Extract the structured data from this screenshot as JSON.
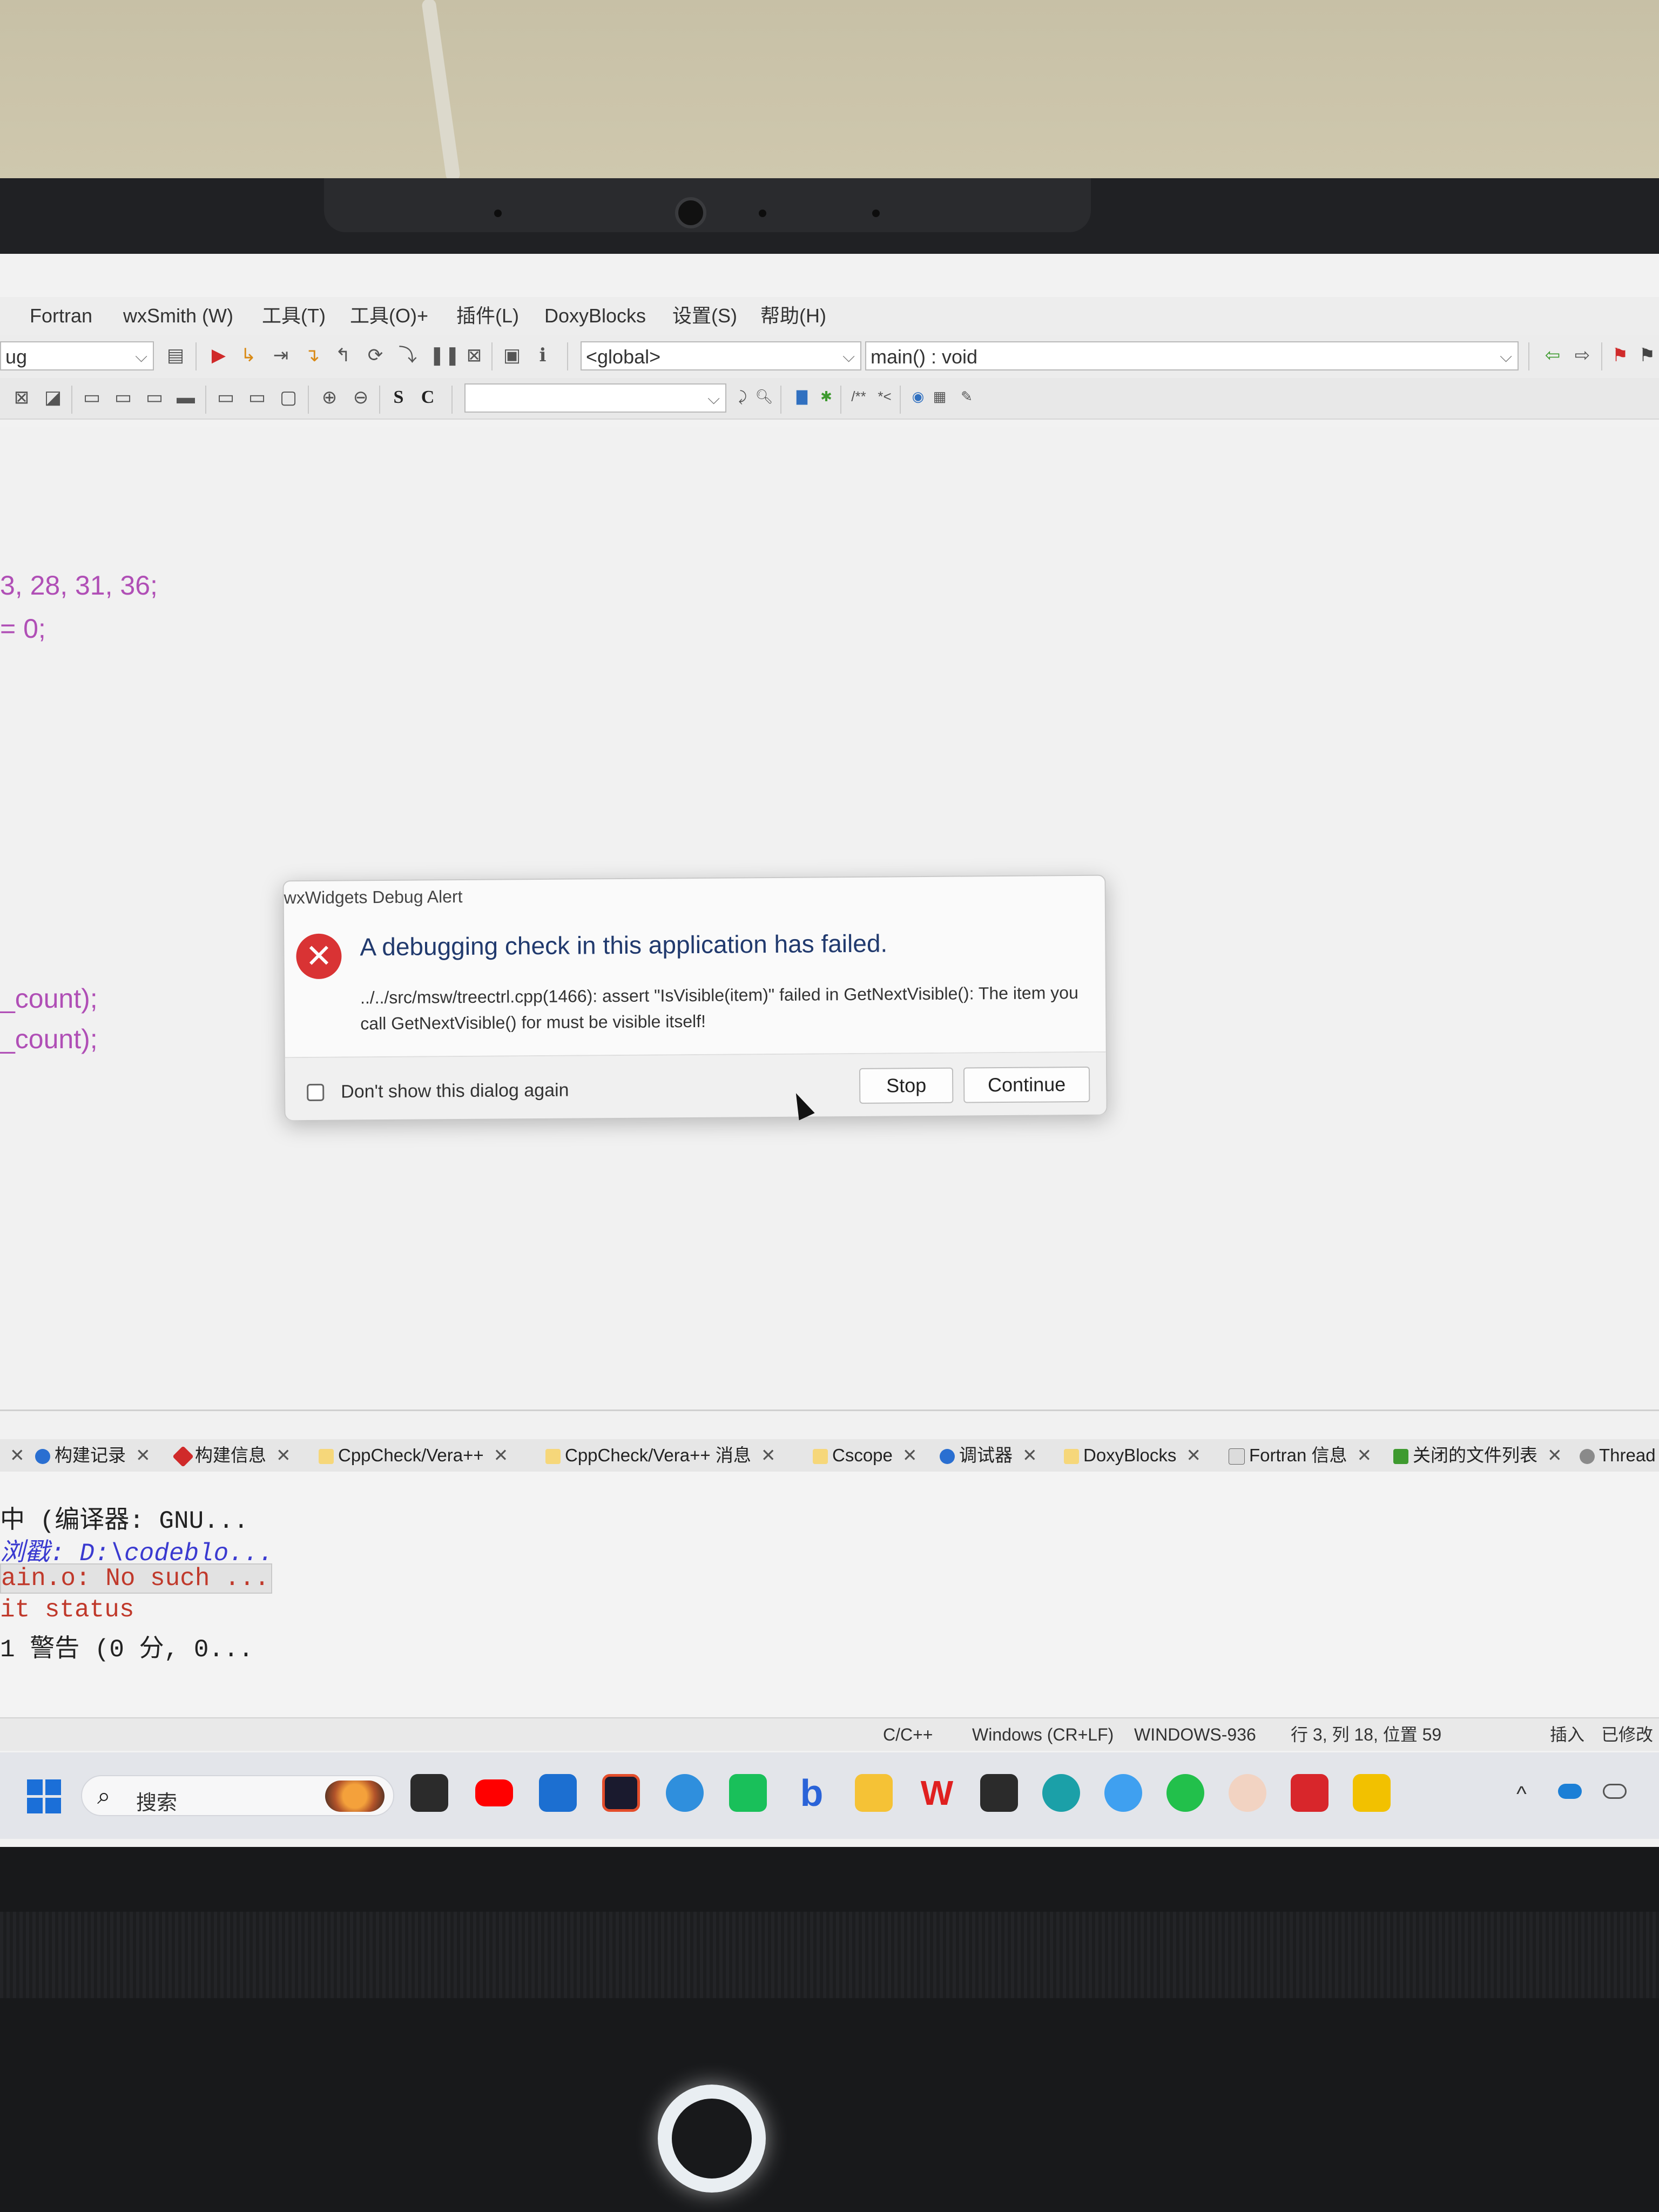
{
  "menubar": {
    "items": [
      "Fortran",
      "wxSmith (W)",
      "工具(T)",
      "工具(O)+",
      "插件(L)",
      "DoxyBlocks",
      "设置(S)",
      "帮助(H)"
    ]
  },
  "toolbar": {
    "build_target_fragment": "ug",
    "scope_combo": "<global>",
    "function_combo": "main() : void",
    "bold_s": "S",
    "bold_c": "C"
  },
  "editor": {
    "visible_code_fragments": [
      "3, 28, 31, 36;",
      "= 0;",
      "_count);",
      "_count);"
    ]
  },
  "dialog": {
    "title": "wxWidgets Debug Alert",
    "heading": "A debugging check in this application has failed.",
    "message": "../../src/msw/treectrl.cpp(1466): assert \"IsVisible(item)\" failed in GetNextVisible(): The item you call GetNextVisible() for must be visible itself!",
    "dont_show_label": "Don't show this dialog again",
    "stop_label": "Stop",
    "continue_label": "Continue"
  },
  "log_tabs": [
    {
      "label": "构建记录"
    },
    {
      "label": "构建信息"
    },
    {
      "label": "CppCheck/Vera++"
    },
    {
      "label": "CppCheck/Vera++ 消息"
    },
    {
      "label": "Cscope"
    },
    {
      "label": "调试器"
    },
    {
      "label": "DoxyBlocks"
    },
    {
      "label": "Fortran 信息"
    },
    {
      "label": "关闭的文件列表"
    },
    {
      "label": "Thread"
    }
  ],
  "log_lines": [
    {
      "text": "中 (编译器: GNU...",
      "color": "#222222"
    },
    {
      "text": "浏戳: D:\\codeblo...",
      "color": "#3a3ad0"
    },
    {
      "text": "ain.o: No such ...",
      "color": "#c0392b"
    },
    {
      "text": "it status",
      "color": "#c0392b"
    },
    {
      "text": "1 警告 (0 分, 0...",
      "color": "#222222"
    }
  ],
  "statusbar": {
    "language": "C/C++",
    "line_endings": "Windows (CR+LF)",
    "encoding": "WINDOWS-936",
    "position": "行 3, 列 18, 位置 59",
    "insert": "插入",
    "modified": "已修改"
  },
  "taskbar": {
    "search_label": "搜索",
    "colors": {
      "start": "#1b6fd8"
    }
  }
}
